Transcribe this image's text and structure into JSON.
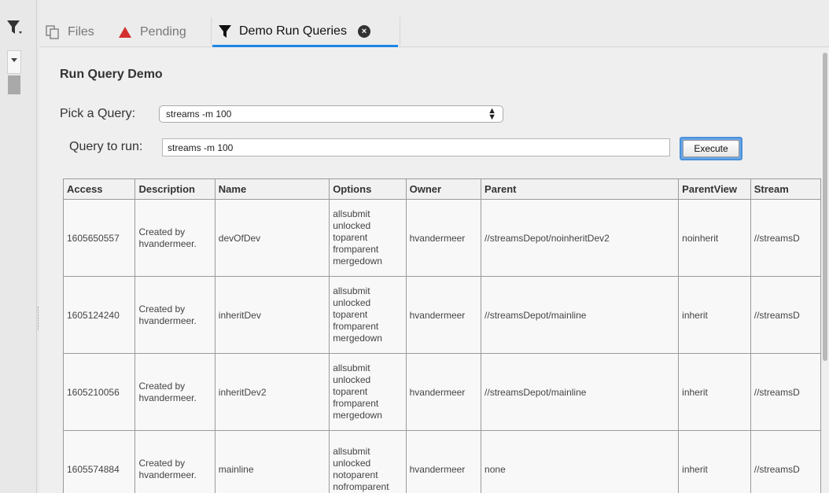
{
  "tabs": [
    {
      "label": "Files",
      "icon": "files-icon",
      "active": false
    },
    {
      "label": "Pending",
      "icon": "warning-triangle-icon",
      "active": false
    },
    {
      "label": "Demo Run Queries",
      "icon": "filter-icon",
      "active": true
    }
  ],
  "page": {
    "title": "Run Query Demo",
    "pick_label": "Pick a Query:",
    "pick_value": "streams -m 100",
    "query_label": "Query to run:",
    "query_value": "streams -m 100",
    "execute_label": "Execute"
  },
  "table": {
    "headers": [
      "Access",
      "Description",
      "Name",
      "Options",
      "Owner",
      "Parent",
      "ParentView",
      "Stream"
    ],
    "rows": [
      [
        "1605650557",
        "Created by hvandermeer.",
        "devOfDev",
        "allsubmit unlocked toparent fromparent mergedown",
        "hvandermeer",
        "//streamsDepot/noinheritDev2",
        "noinherit",
        "//streamsD"
      ],
      [
        "1605124240",
        "Created by hvandermeer.",
        "inheritDev",
        "allsubmit unlocked toparent fromparent mergedown",
        "hvandermeer",
        "//streamsDepot/mainline",
        "inherit",
        "//streamsD"
      ],
      [
        "1605210056",
        "Created by hvandermeer.",
        "inheritDev2",
        "allsubmit unlocked toparent fromparent mergedown",
        "hvandermeer",
        "//streamsDepot/mainline",
        "inherit",
        "//streamsD"
      ],
      [
        "1605574884",
        "Created by hvandermeer.",
        "mainline",
        "allsubmit unlocked notoparent nofromparent",
        "hvandermeer",
        "none",
        "inherit",
        "//streamsD"
      ]
    ]
  },
  "colors": {
    "accent": "#1e88e5",
    "pending_red": "#d32f2f",
    "execute_focus": "#4a90d9"
  }
}
